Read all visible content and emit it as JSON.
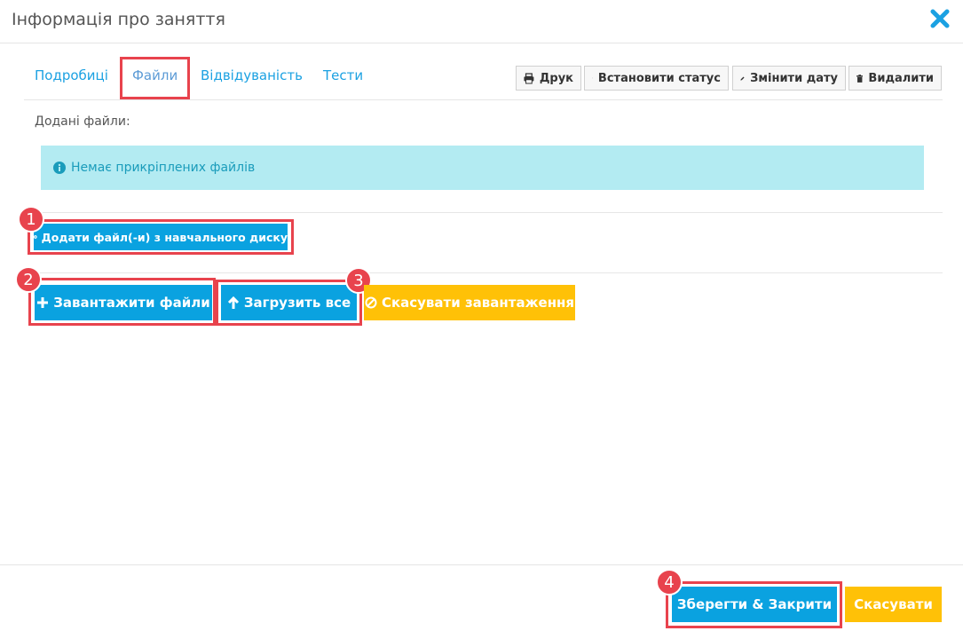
{
  "modal": {
    "title": "Інформація про заняття"
  },
  "tabs": [
    "Подробиці",
    "Файли",
    "Відвідуваність",
    "Тести"
  ],
  "toolbar": {
    "print": "Друк",
    "set_status": "Встановити статус",
    "change_date": "Змінити дату",
    "delete": "Видалити"
  },
  "files": {
    "label": "Додані файли:",
    "empty_alert": "Немає прикріплених файлів"
  },
  "actions": {
    "add_from_disk": "Додати файл(-и) з навчального диску",
    "upload_files": "Завантажити файли",
    "upload_all": "Загрузить все",
    "cancel_upload": "Скасувати завантаження"
  },
  "footer": {
    "save_close": "Зберегти & Закрити",
    "cancel": "Скасувати"
  },
  "annotations": [
    "1",
    "2",
    "3",
    "4"
  ],
  "colors": {
    "primary": "#0aa2e0",
    "warning": "#ffc107",
    "alert_bg": "#b3ebf2",
    "highlight": "#e8434d"
  }
}
